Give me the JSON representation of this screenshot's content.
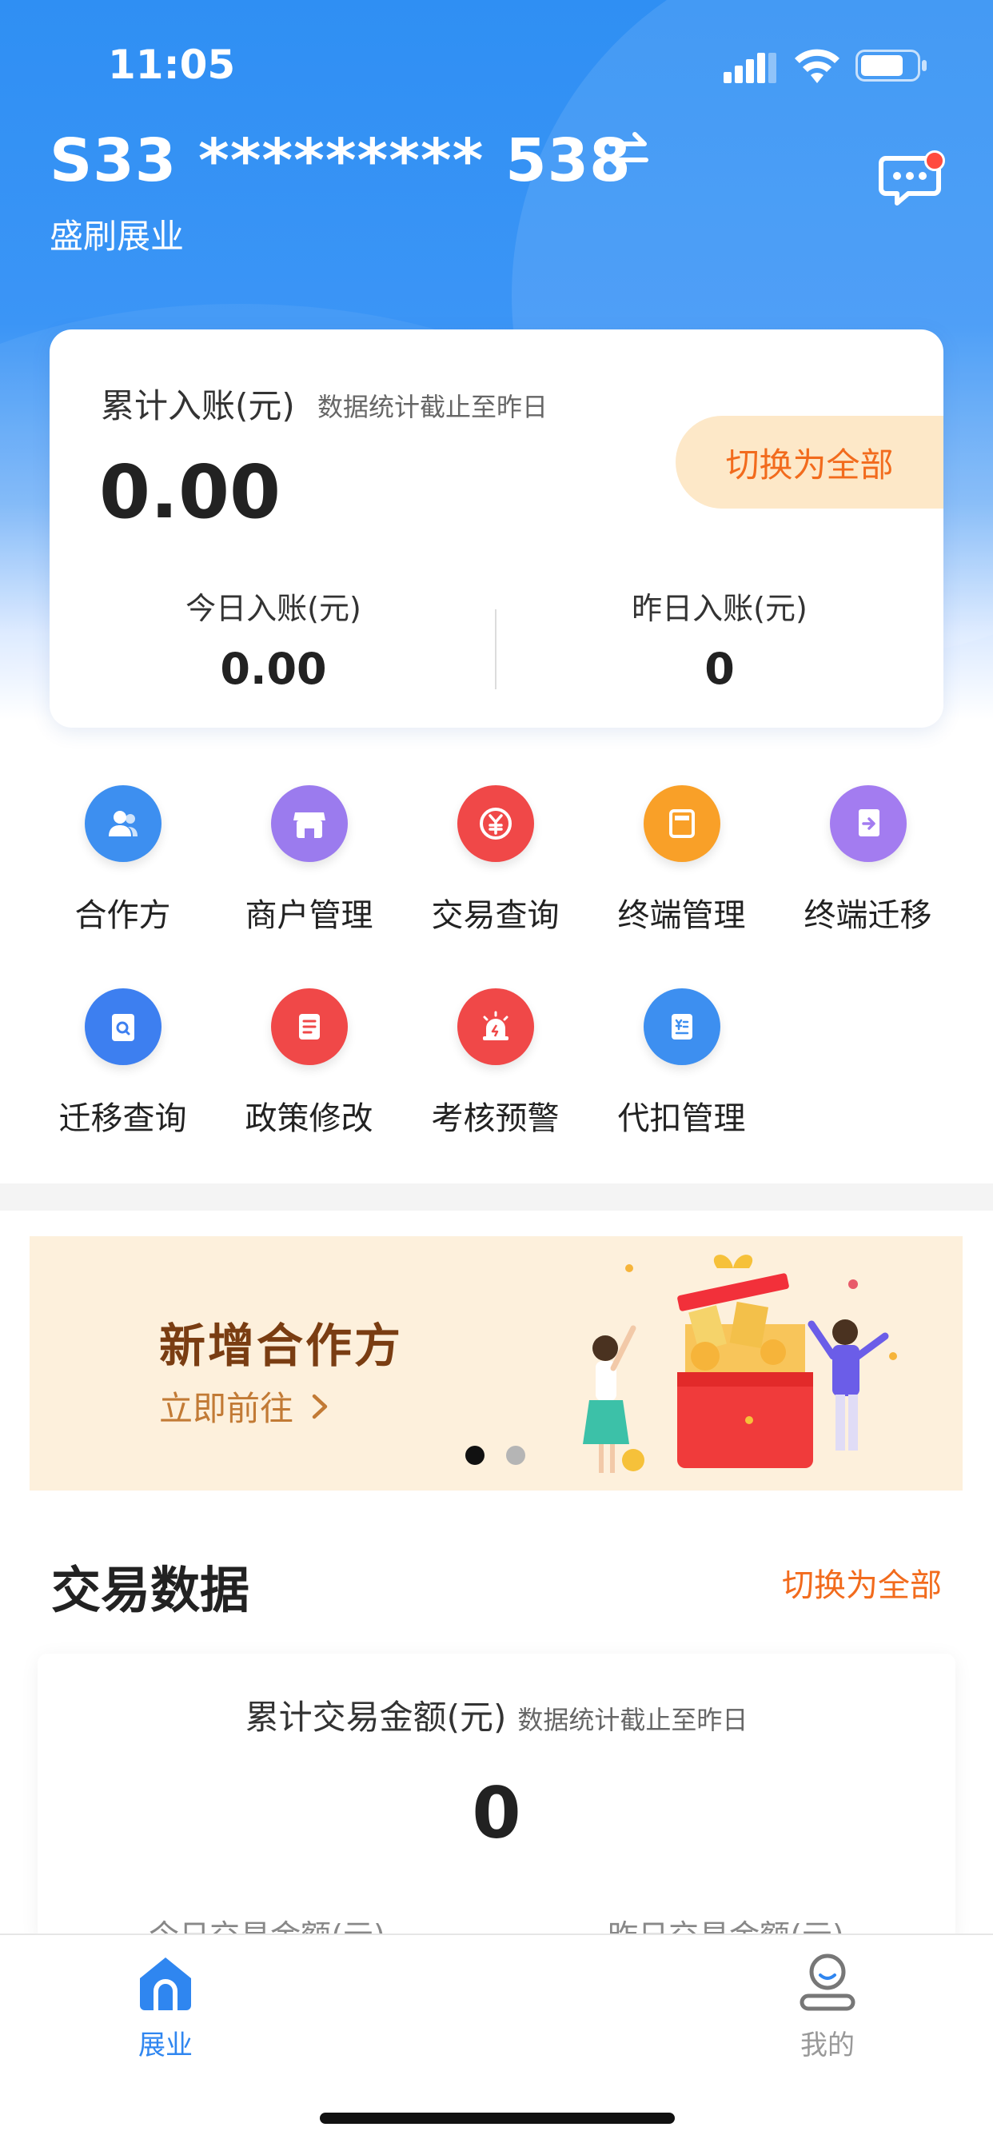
{
  "status_bar": {
    "time": "11:05"
  },
  "header": {
    "account": "S33 ********* 538",
    "company": "盛刷展业"
  },
  "summary": {
    "label": "累计入账(元)",
    "note": "数据统计截止至昨日",
    "total": "0.00",
    "switch_label": "切换为全部",
    "today_label": "今日入账(元)",
    "today_value": "0.00",
    "yesterday_label": "昨日入账(元)",
    "yesterday_value": "0"
  },
  "menu": [
    {
      "label": "合作方",
      "icon": "partners-icon",
      "color": "#3d8ff0"
    },
    {
      "label": "商户管理",
      "icon": "store-icon",
      "color": "#9b7bee"
    },
    {
      "label": "交易查询",
      "icon": "currency-exchange-icon",
      "color": "#f04848"
    },
    {
      "label": "终端管理",
      "icon": "terminal-icon",
      "color": "#f9a028"
    },
    {
      "label": "终端迁移",
      "icon": "migrate-icon",
      "color": "#a37cf0"
    },
    {
      "label": "迁移查询",
      "icon": "search-doc-icon",
      "color": "#3d7ff0"
    },
    {
      "label": "政策修改",
      "icon": "policy-doc-icon",
      "color": "#f04848"
    },
    {
      "label": "考核预警",
      "icon": "alarm-icon",
      "color": "#f04848"
    },
    {
      "label": "代扣管理",
      "icon": "withhold-doc-icon",
      "color": "#3d8ff0"
    }
  ],
  "banner": {
    "title": "新增合作方",
    "link_label": "立即前往"
  },
  "transaction": {
    "section_title": "交易数据",
    "switch_label": "切换为全部",
    "label": "累计交易金额(元)",
    "note": "数据统计截止至昨日",
    "total": "0",
    "today_label": "今日交易金额(元)",
    "yesterday_label": "昨日交易金额(元)"
  },
  "tabs": {
    "home_label": "展业",
    "mine_label": "我的"
  },
  "colors": {
    "brand_blue": "#2f8ff3",
    "accent_orange": "#f26b1d"
  }
}
